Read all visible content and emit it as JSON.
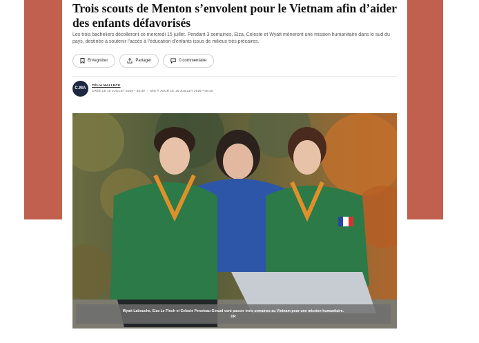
{
  "article": {
    "title": "Trois scouts de Menton s’envolent pour le Vietnam afin d’aider des enfants défavorisés",
    "lede": "Les trois bacheliers décolleront ce mercredi 15 juillet. Pendant 3 semaines, Eiza, Celeste et Wyatt mèneront une mission humanitaire dans le sud du pays, destinée à soutenir l’accès à l’éducation d’enfants issus de milieux très précaires."
  },
  "actions": {
    "save_label": "Enregistrer",
    "share_label": "Partager",
    "comments_label": "0 commentaire"
  },
  "author": {
    "initials": "C.MA",
    "name": "CÉLIA MALLECK",
    "created": "CRÉÉ LE 15 JUILLET 2026 • 08:30",
    "updated": "MIS À JOUR LE 15 JUILLET 2026 • 08:30"
  },
  "photo": {
    "caption": "Wyatt Labouche, Eiza Le Floch et Celeste Penoteau-Giraud vont passer trois semaines au Vietnam pour une mission humanitaire.",
    "credit": "DR"
  },
  "colors": {
    "accent_band": "#c1604e",
    "avatar_bg": "#1d2740"
  },
  "icons": {
    "save": "bookmark-icon",
    "share": "share-icon",
    "comments": "comment-icon"
  }
}
